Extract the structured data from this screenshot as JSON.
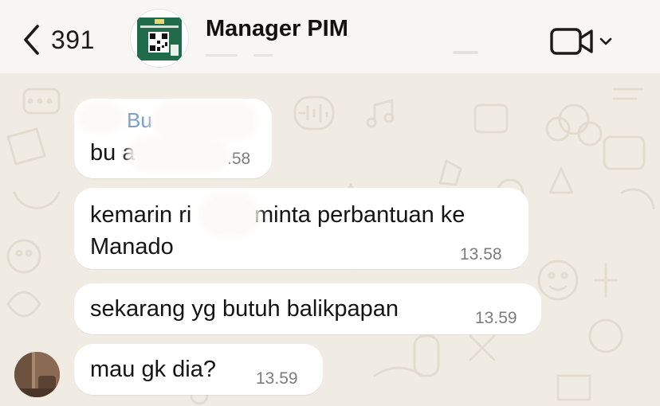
{
  "header": {
    "back_count": "391",
    "title": "Manager PIM"
  },
  "messages": [
    {
      "sender": "Bu",
      "text": "bu a",
      "time": ".58"
    },
    {
      "lines": [
        "kemarin ri",
        "minta perbantuan ke",
        "Manado"
      ],
      "time": "13.58"
    },
    {
      "text": "sekarang yg butuh balikpapan",
      "time": "13.59"
    },
    {
      "text": "mau gk dia?",
      "time": "13.59"
    }
  ],
  "icons": {
    "back": "chevron-left-icon",
    "video": "video-camera-icon",
    "dropdown": "chevron-down-icon"
  },
  "colors": {
    "header_bg": "#f7f6f4",
    "chat_bg": "#f1ece3",
    "bubble_bg": "#ffffff",
    "sender_name": "#7b9cc8",
    "time_text": "#7c7c7c",
    "group_green": "#1f6b4a"
  }
}
